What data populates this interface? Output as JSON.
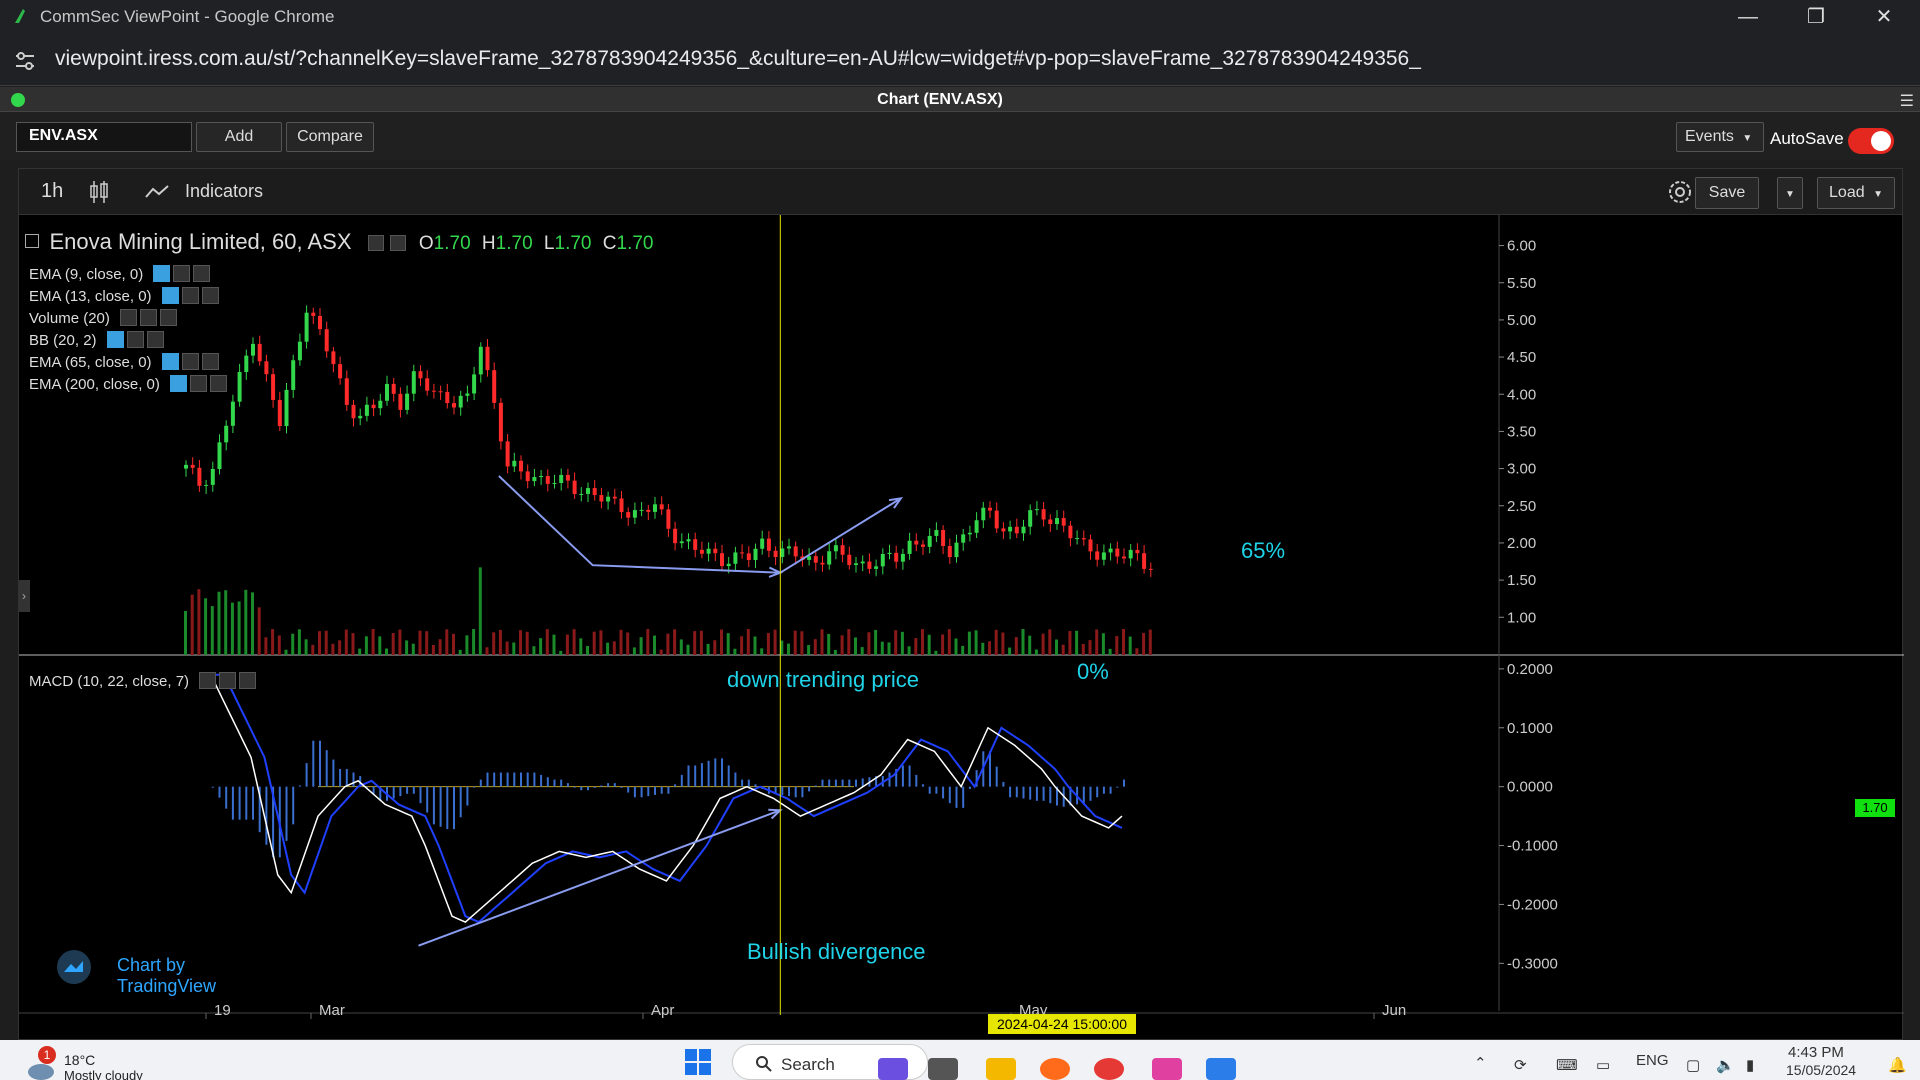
{
  "browser": {
    "window_title": "CommSec ViewPoint - Google Chrome",
    "url": "viewpoint.iress.com.au/st/?channelKey=slaveFrame_3278783904249356_&culture=en-AU#lcw=widget#vp-pop=slaveFrame_3278783904249356_"
  },
  "app": {
    "title": "Chart (ENV.ASX)",
    "symbol_value": "ENV.ASX",
    "add_label": "Add",
    "compare_label": "Compare",
    "events_label": "Events",
    "autosave_label": "AutoSave",
    "autosave_on": true
  },
  "chart_toolbar": {
    "interval": "1h",
    "indicators_label": "Indicators",
    "save_label": "Save",
    "load_label": "Load"
  },
  "legend": {
    "symbol_title": "Enova Mining Limited, 60, ASX",
    "open_label": "O",
    "open": "1.70",
    "high_label": "H",
    "high": "1.70",
    "low_label": "L",
    "low": "1.70",
    "close_label": "C",
    "close": "1.70",
    "indicators": [
      "EMA (9, close, 0)",
      "EMA (13, close, 0)",
      "Volume (20)",
      "BB (20, 2)",
      "EMA (65, close, 0)",
      "EMA (200, close, 0)"
    ],
    "macd_label": "MACD (10, 22, close, 7)"
  },
  "annotations": {
    "down_trend": "down trending price",
    "zero_pct": "0%",
    "sixty_five_pct": "65%",
    "bullish": "Bullish divergence"
  },
  "branding": "Chart by TradingView",
  "last_price_tag": "1.70",
  "crosshair_time": "2024-04-24 15:00:00",
  "chart_data": {
    "type": "candlestick",
    "price_axis_ticks": [
      "6.00",
      "5.50",
      "5.00",
      "4.50",
      "4.00",
      "3.50",
      "3.00",
      "2.50",
      "2.00",
      "1.50",
      "1.00"
    ],
    "price_ylim": [
      0.6,
      6.25
    ],
    "macd_axis_ticks": [
      "0.2000",
      "0.1000",
      "0.0000",
      "-0.1000",
      "-0.2000",
      "-0.3000"
    ],
    "macd_ylim": [
      -0.33,
      0.21
    ],
    "x_ticks": [
      "19",
      "Mar",
      "Apr",
      "May",
      "Jun"
    ],
    "price_path": [
      [
        0,
        3.0
      ],
      [
        2,
        2.8
      ],
      [
        4,
        3.0
      ],
      [
        8,
        4.2
      ],
      [
        10,
        4.8
      ],
      [
        12,
        4.2
      ],
      [
        14,
        3.6
      ],
      [
        16,
        4.4
      ],
      [
        18,
        5.2
      ],
      [
        20,
        4.8
      ],
      [
        22,
        4.4
      ],
      [
        24,
        3.9
      ],
      [
        26,
        3.7
      ],
      [
        28,
        3.8
      ],
      [
        30,
        4.1
      ],
      [
        32,
        3.9
      ],
      [
        34,
        4.2
      ],
      [
        36,
        4.1
      ],
      [
        38,
        4.0
      ],
      [
        40,
        3.9
      ],
      [
        42,
        3.9
      ],
      [
        44,
        4.7
      ],
      [
        46,
        3.9
      ],
      [
        48,
        3.0
      ],
      [
        52,
        2.9
      ],
      [
        56,
        2.8
      ],
      [
        60,
        2.7
      ],
      [
        64,
        2.5
      ],
      [
        68,
        2.4
      ],
      [
        70,
        2.5
      ],
      [
        72,
        2.2
      ],
      [
        76,
        1.9
      ],
      [
        80,
        1.8
      ],
      [
        84,
        1.8
      ],
      [
        86,
        2.0
      ],
      [
        90,
        1.85
      ],
      [
        94,
        1.75
      ],
      [
        96,
        1.9
      ],
      [
        98,
        1.8
      ],
      [
        100,
        1.72
      ],
      [
        104,
        1.75
      ],
      [
        106,
        1.8
      ],
      [
        108,
        2.0
      ],
      [
        112,
        2.05
      ],
      [
        114,
        1.9
      ],
      [
        116,
        2.1
      ],
      [
        118,
        2.3
      ],
      [
        120,
        2.4
      ],
      [
        122,
        2.2
      ],
      [
        124,
        2.15
      ],
      [
        126,
        2.35
      ],
      [
        128,
        2.4
      ],
      [
        130,
        2.3
      ],
      [
        132,
        2.1
      ],
      [
        134,
        1.95
      ],
      [
        136,
        1.9
      ],
      [
        138,
        1.85
      ],
      [
        140,
        1.8
      ],
      [
        142,
        1.85
      ],
      [
        144,
        1.7
      ]
    ],
    "macd_path": [
      [
        4,
        0.19
      ],
      [
        10,
        0.05
      ],
      [
        14,
        -0.15
      ],
      [
        16,
        -0.18
      ],
      [
        20,
        -0.05
      ],
      [
        24,
        0.0
      ],
      [
        26,
        0.01
      ],
      [
        30,
        -0.03
      ],
      [
        34,
        -0.05
      ],
      [
        36,
        -0.1
      ],
      [
        40,
        -0.22
      ],
      [
        42,
        -0.23
      ],
      [
        46,
        -0.19
      ],
      [
        52,
        -0.13
      ],
      [
        56,
        -0.11
      ],
      [
        60,
        -0.12
      ],
      [
        64,
        -0.11
      ],
      [
        68,
        -0.14
      ],
      [
        72,
        -0.16
      ],
      [
        76,
        -0.1
      ],
      [
        80,
        -0.02
      ],
      [
        84,
        0.0
      ],
      [
        88,
        -0.02
      ],
      [
        92,
        -0.05
      ],
      [
        96,
        -0.03
      ],
      [
        100,
        -0.01
      ],
      [
        104,
        0.02
      ],
      [
        108,
        0.08
      ],
      [
        112,
        0.06
      ],
      [
        116,
        0.0
      ],
      [
        120,
        0.1
      ],
      [
        124,
        0.07
      ],
      [
        128,
        0.03
      ],
      [
        130,
        0.0
      ],
      [
        134,
        -0.05
      ],
      [
        138,
        -0.07
      ],
      [
        140,
        -0.05
      ]
    ],
    "down_trend_line": [
      [
        47,
        2.9
      ],
      [
        61,
        1.7
      ],
      [
        89,
        1.6
      ]
    ],
    "up_trend_line": [
      [
        89,
        1.6
      ],
      [
        107,
        2.6
      ]
    ],
    "divergence_line": [
      [
        35,
        -0.27
      ],
      [
        89,
        -0.04
      ]
    ]
  },
  "taskbar": {
    "weather_badge": "1",
    "temp": "18°C",
    "weather_desc": "Mostly cloudy",
    "search_label": "Search",
    "lang": "ENG",
    "time": "4:43 PM",
    "date": "15/05/2024"
  },
  "colors": {
    "up": "#32d74b",
    "down": "#ff2a2a",
    "accent": "#1fd3e8",
    "crosshair": "#e6e600"
  }
}
